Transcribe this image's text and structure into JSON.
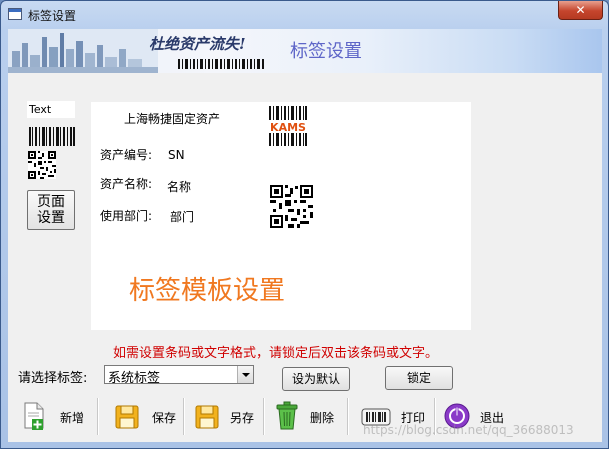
{
  "window": {
    "title": "标签设置",
    "close_label": "✕"
  },
  "banner": {
    "slogan": "杜绝资产流失!",
    "title": "标签设置"
  },
  "left_panel": {
    "text_element": "Text",
    "page_setup_line1": "页面",
    "page_setup_line2": "设置"
  },
  "label_canvas": {
    "company": "上海畅捷固定资产",
    "logo_text": "KAMS",
    "fields": [
      {
        "label": "资产编号:",
        "value": "SN"
      },
      {
        "label": "资产名称:",
        "value": "名称"
      },
      {
        "label": "使用部门:",
        "value": "部门"
      }
    ],
    "template_title": "标签模板设置"
  },
  "hint": "如需设置条码或文字格式，请锁定后双击该条码或文字。",
  "tag_select": {
    "label": "请选择标签:",
    "value": "系统标签"
  },
  "buttons": {
    "set_default": "设为默认",
    "lock": "锁定"
  },
  "toolbar": [
    {
      "label": "新增",
      "icon": "add-document-icon"
    },
    {
      "label": "保存",
      "icon": "save-folder-icon"
    },
    {
      "label": "另存",
      "icon": "save-as-folder-icon"
    },
    {
      "label": "删除",
      "icon": "trash-icon"
    },
    {
      "label": "打印",
      "icon": "barcode-printer-icon"
    },
    {
      "label": "退出",
      "icon": "power-icon"
    }
  ],
  "watermark": "https://blog.csdn.net/qq_36688013",
  "colors": {
    "template_title": "#f07820",
    "hint": "#d00000",
    "banner_title": "#5e66c8"
  }
}
